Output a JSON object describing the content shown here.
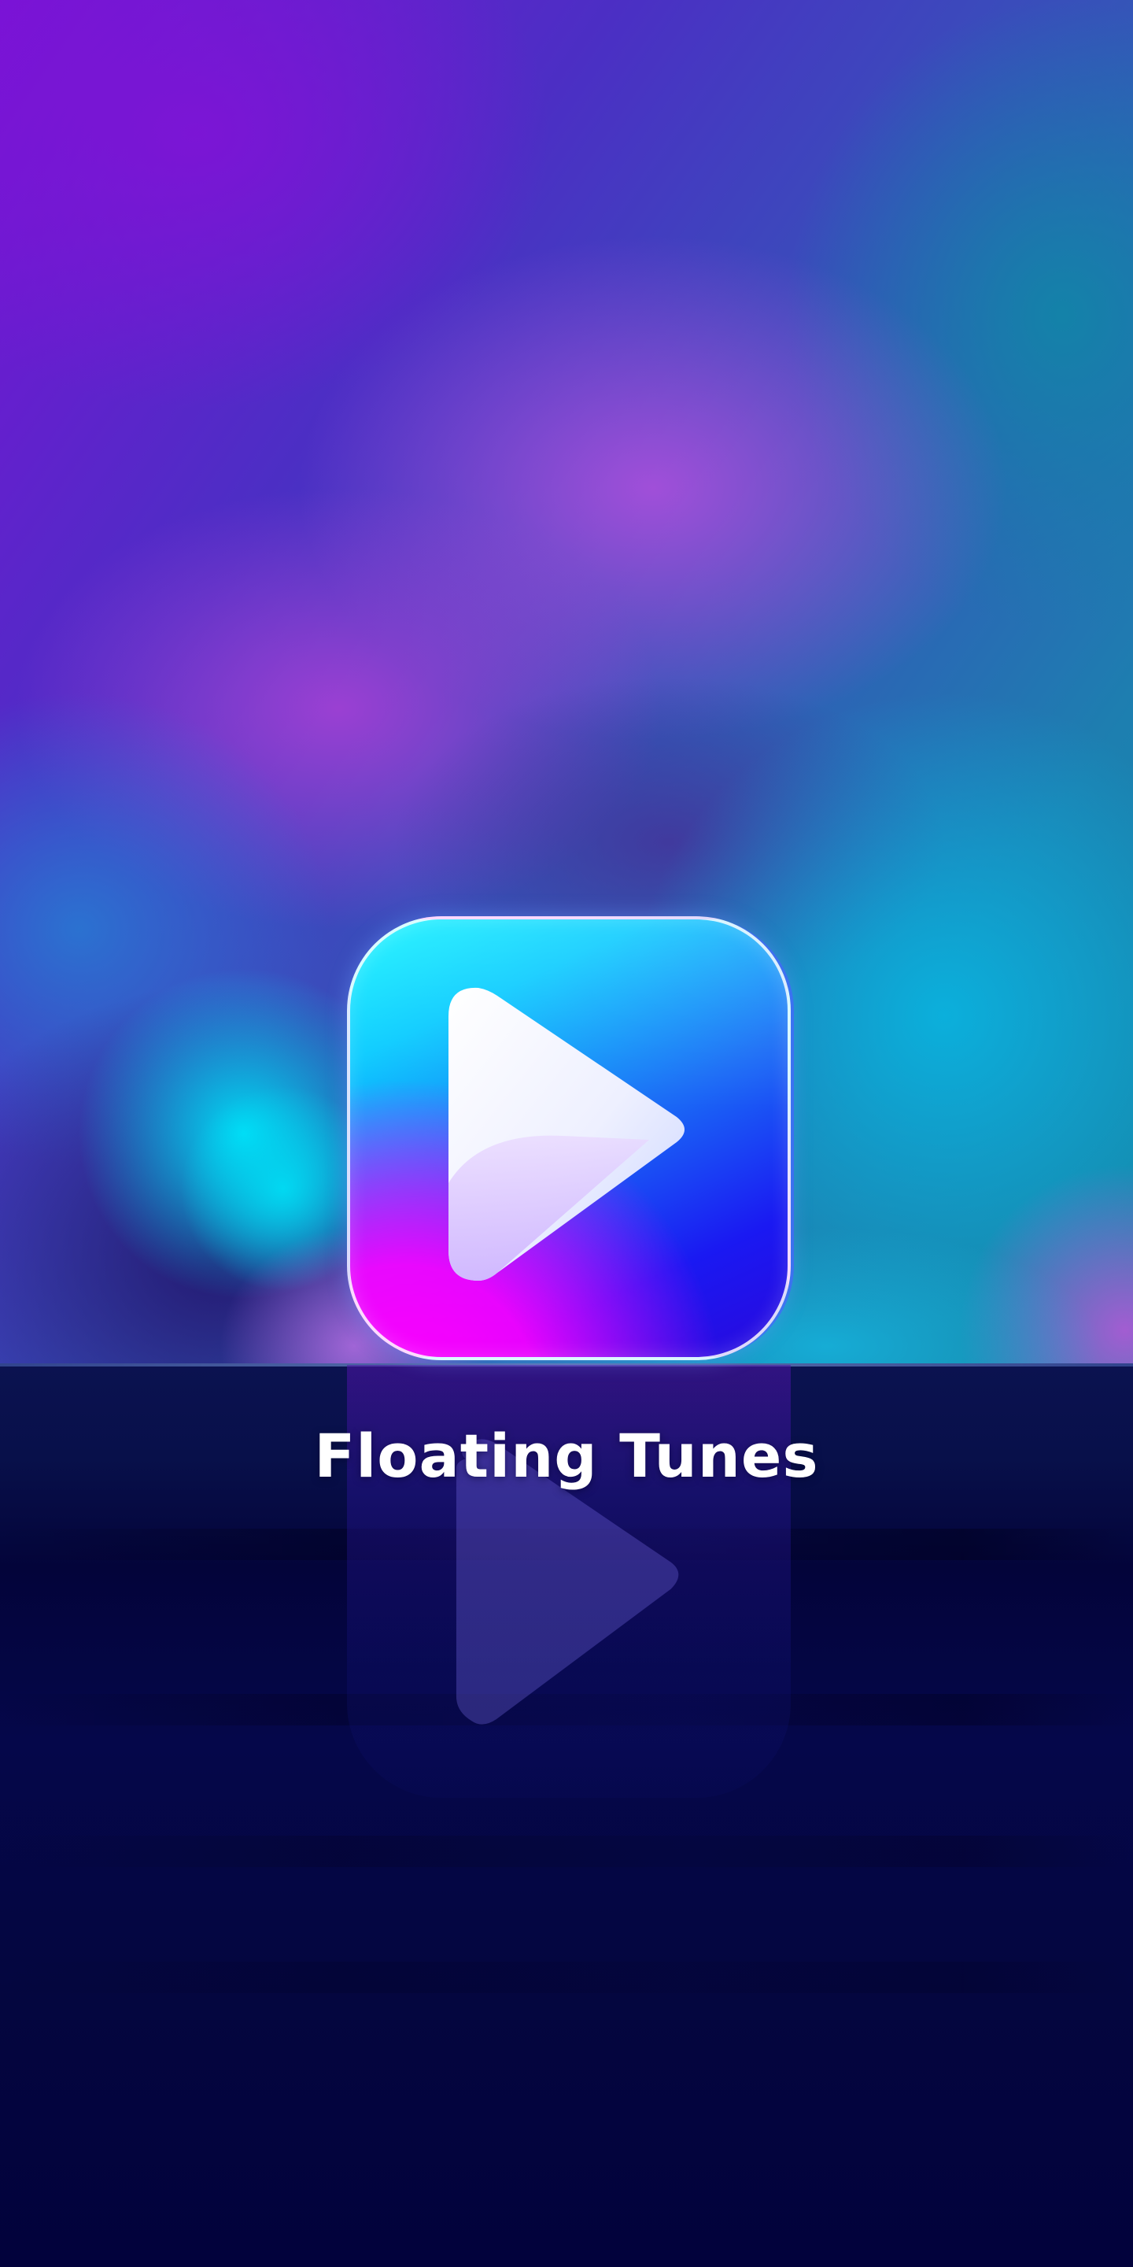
{
  "app": {
    "title": "Floating Tunes"
  },
  "icon": {
    "name": "play-icon",
    "gradient_colors": [
      "#0af6ff",
      "#1a19f2",
      "#ff00ff"
    ],
    "glyph_color": "#ffffff"
  },
  "background": {
    "colors": [
      "#7a12d6",
      "#b250de",
      "#0ab2de",
      "#138aa8"
    ],
    "floor_color": "#05063f"
  }
}
